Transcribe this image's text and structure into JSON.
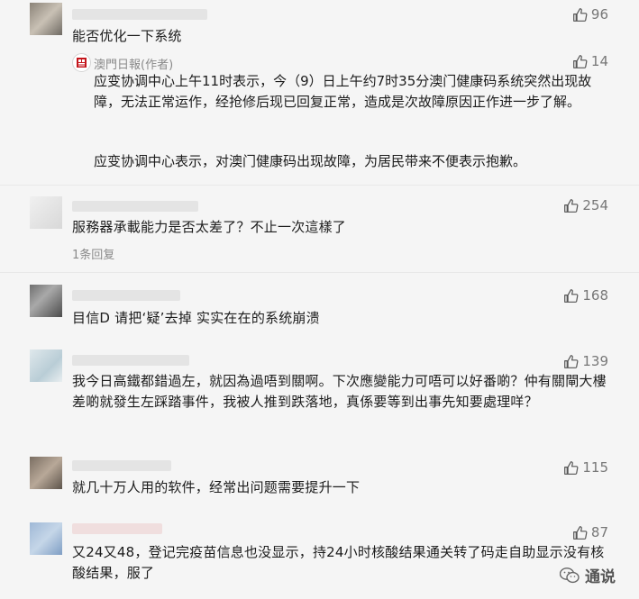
{
  "comments": [
    {
      "likes": "96",
      "text": "能否优化一下系统",
      "author_reply": {
        "author": "澳門日報(作者)",
        "likes": "14",
        "paragraph1": "应变协调中心上午11时表示，今（9）日上午约7时35分澳门健康码系统突然出现故障，无法正常运作，经抢修后现已回复正常，造成是次故障原因正作进一步了解。",
        "paragraph2": "应变协调中心表示，对澳门健康码出现故障，为居民带来不便表示抱歉。"
      }
    },
    {
      "likes": "254",
      "text": "服務器承載能力是否太差了？不止一次這樣了",
      "reply_count": "1条回复"
    },
    {
      "likes": "168",
      "text": "目信D 请把‘疑’去掉 实实在在的系统崩溃"
    },
    {
      "likes": "139",
      "text": "我今日高鐵都錯過左，就因為過唔到關啊。下次應變能力可唔可以好番啲？仲有關閘大樓差啲就發生左踩踏事件，我被人推到跌落地，真係要等到出事先知要處理咩？"
    },
    {
      "likes": "115",
      "text": "就几十万人用的软件，经常出问题需要提升一下"
    },
    {
      "likes": "87",
      "text": "又24又48，登记完疫苗信息也没显示，持24小时核酸结果通关转了码走自助显示没有核酸结果，服了"
    }
  ],
  "watermark": "通说",
  "colors": {
    "background": "#f5f5f5",
    "text": "#1c1c1c",
    "muted": "#8a8a8a",
    "badge_red": "#c4161c"
  },
  "icons": [
    "thumbs-up-icon",
    "newspaper-logo-icon",
    "wechat-logo-icon"
  ]
}
